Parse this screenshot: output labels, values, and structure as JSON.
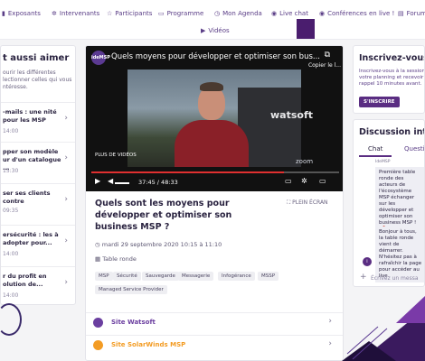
{
  "nav": {
    "items": [
      {
        "icon": "chart-icon",
        "glyph": "▮",
        "label": "Exposants"
      },
      {
        "icon": "gear-icon",
        "glyph": "✲",
        "label": "Intervenants"
      },
      {
        "icon": "star-icon",
        "glyph": "☆",
        "label": "Participants"
      },
      {
        "icon": "calendar-icon",
        "glyph": "▭",
        "label": "Programme"
      },
      {
        "icon": "clock-icon",
        "glyph": "◷",
        "label": "Mon Agenda"
      },
      {
        "icon": "live-icon",
        "glyph": "◉",
        "label": "Live chat"
      },
      {
        "icon": "conference-icon",
        "glyph": "◉",
        "label": "Conférences en live !"
      },
      {
        "icon": "forum-icon",
        "glyph": "▤",
        "label": "Forum"
      },
      {
        "icon": "play-icon",
        "glyph": "▶",
        "label": "Vidéos"
      }
    ]
  },
  "sidebar": {
    "title": "t aussi aimer",
    "description": "ourir les différentes lectionner celles qui vous ntéresse.",
    "items": [
      {
        "title": "-mails : une nité pour les MSP",
        "time": "14:00"
      },
      {
        "title": "pper son modèle ur d'un catalogue ...",
        "time": "15:30"
      },
      {
        "title": "ser ses clients contre",
        "time": "09:35"
      },
      {
        "title": "ersécurité : les à adopter pour...",
        "time": "14:00"
      },
      {
        "title": "r du profit en olution de...",
        "time": "14:00"
      }
    ]
  },
  "video": {
    "logo_text": "ideMSP",
    "title": "Quels moyens pour développer et optimiser son bus...",
    "copy_label": "Copier le l...",
    "more_videos": "PLUS DE VIDÉOS",
    "time": "37:45 / 48:33",
    "progress": 0.777,
    "scene_text": "watsoft",
    "zoom_text": "zoom"
  },
  "session": {
    "title": "Quels sont les moyens pour développer et optimiser son business MSP ?",
    "fullscreen_label": "PLEIN ÉCRAN",
    "date": "mardi 29 septembre 2020 10:15 à 11:10",
    "format": "Table ronde",
    "tags": [
      "MSP",
      "Sécurité",
      "Sauvegarde",
      "Messagerie",
      "Infogérance",
      "MSSP",
      "Managed Service Provider"
    ],
    "links": [
      {
        "label": "Site Watsoft",
        "color": "#6b3fa0"
      },
      {
        "label": "Site SolarWinds MSP",
        "color": "#f39c24"
      }
    ]
  },
  "register": {
    "title": "Inscrivez-vous",
    "description": "Inscrivez-vous à la session votre planning et recevoir rappel 10 minutes avant.",
    "button_label": "S'INSCRIRE"
  },
  "chat": {
    "title": "Discussion intera",
    "tabs": [
      "Chat",
      "Question"
    ],
    "from": "IdeMSP",
    "messages": [
      "Première table ronde des acteurs de l'écosystème MSP échanger sur les développer et optimiser son business MSP ! 🚀",
      "Bonjour à tous, la table ronde vient de démarrer. N'hésitez pas à rafraîchir la page pour accéder au live."
    ],
    "avatar_letter": "i",
    "input_placeholder": "Écrivez un messa"
  },
  "colors": {
    "accent": "#5a2d82",
    "nav_text": "#5a3d86",
    "progress": "#e03030"
  }
}
